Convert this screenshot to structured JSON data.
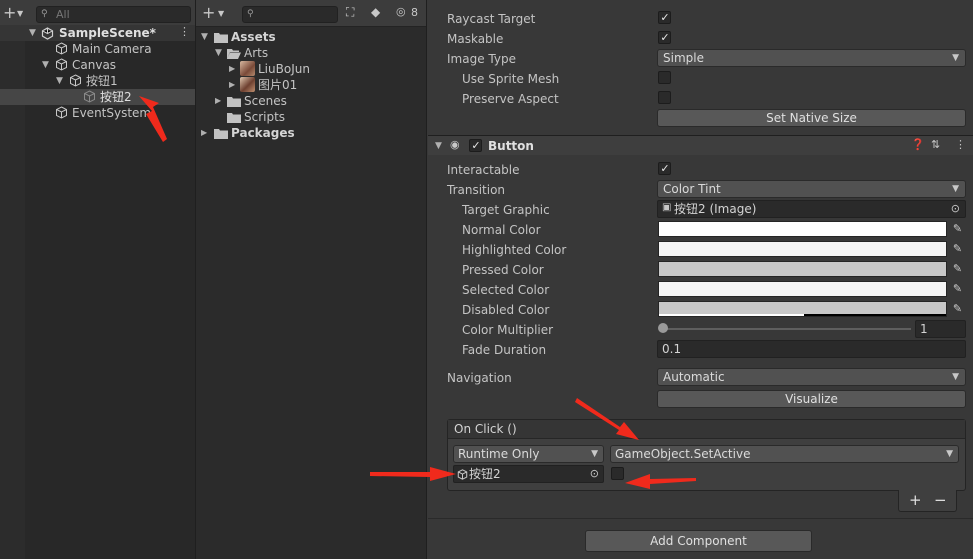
{
  "hierarchy": {
    "search_placeholder": "All",
    "scene": "SampleScene*",
    "items": [
      "Main Camera",
      "Canvas",
      "按钮1",
      "按钮2",
      "EventSystem"
    ]
  },
  "project": {
    "badge": "8",
    "items": [
      "Assets",
      "Arts",
      "LiuBoJun",
      "图片01",
      "Scenes",
      "Scripts",
      "Packages"
    ]
  },
  "image_component": {
    "raycast_target": "Raycast Target",
    "maskable": "Maskable",
    "image_type_label": "Image Type",
    "image_type_value": "Simple",
    "use_sprite_mesh": "Use Sprite Mesh",
    "preserve_aspect": "Preserve Aspect",
    "set_native_size": "Set Native Size"
  },
  "button_component": {
    "title": "Button",
    "interactable": "Interactable",
    "transition_label": "Transition",
    "transition_value": "Color Tint",
    "target_graphic_label": "Target Graphic",
    "target_graphic_value": "按钮2 (Image)",
    "normal_color": "Normal Color",
    "highlighted_color": "Highlighted Color",
    "pressed_color": "Pressed Color",
    "selected_color": "Selected Color",
    "disabled_color": "Disabled Color",
    "color_multiplier_label": "Color Multiplier",
    "color_multiplier_value": "1",
    "color_multiplier_fraction": 0,
    "fade_duration_label": "Fade Duration",
    "fade_duration_value": "0.1",
    "navigation_label": "Navigation",
    "navigation_value": "Automatic",
    "visualize": "Visualize",
    "onclick_title": "On Click ()",
    "runtime_value": "Runtime Only",
    "function_value": "GameObject.SetActive",
    "object_value": "按钮2",
    "plus": "+",
    "minus": "−"
  },
  "add_component": "Add Component",
  "colors": {
    "normal": "#ffffff",
    "highlighted": "#f5f5f5",
    "pressed": "#c8c8c8",
    "selected": "#f5f5f5",
    "disabled": "#c8c8c8",
    "annotation_arrow": "#f02a1c"
  }
}
